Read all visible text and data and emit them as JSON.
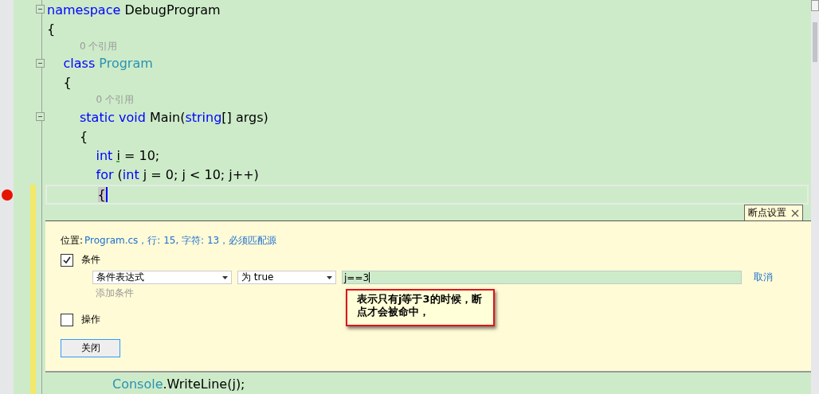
{
  "code": [
    {
      "kind": "code",
      "fold": true,
      "tokens": [
        {
          "text": "namespace",
          "kind": "keyword"
        },
        {
          "text": " DebugProgram",
          "kind": "plain"
        }
      ]
    },
    {
      "kind": "code",
      "tokens": [
        {
          "text": "{",
          "kind": "plain"
        }
      ],
      "children": [
        {
          "kind": "codelens",
          "text": "0 个引用"
        },
        {
          "kind": "code",
          "fold": true,
          "tokens": [
            {
              "text": "class",
              "kind": "keyword"
            },
            {
              "text": " Program",
              "kind": "type"
            }
          ]
        },
        {
          "kind": "code",
          "tokens": [
            {
              "text": "{",
              "kind": "plain"
            }
          ],
          "children": [
            {
              "kind": "codelens",
              "text": "0 个引用"
            },
            {
              "kind": "code",
              "fold": true,
              "tokens": [
                {
                  "text": "static",
                  "kind": "keyword"
                },
                {
                  "text": " void",
                  "kind": "keyword"
                },
                {
                  "text": " Main(",
                  "kind": "plain"
                },
                {
                  "text": "string",
                  "kind": "keyword"
                },
                {
                  "text": "[] args)",
                  "kind": "plain"
                }
              ]
            },
            {
              "kind": "code",
              "tokens": [
                {
                  "text": "{",
                  "kind": "plain"
                }
              ],
              "children": [
                {
                  "kind": "code",
                  "tokens": [
                    {
                      "text": "int ",
                      "kind": "keyword"
                    },
                    {
                      "text": "i",
                      "kind": "warning"
                    },
                    {
                      "text": " = 10;",
                      "kind": "plain"
                    }
                  ]
                },
                {
                  "kind": "code",
                  "tokens": [
                    {
                      "text": "for",
                      "kind": "keyword"
                    },
                    {
                      "text": " (",
                      "kind": "plain"
                    },
                    {
                      "text": "int",
                      "kind": "keyword"
                    },
                    {
                      "text": " j = 0; j < 10; j++)",
                      "kind": "plain"
                    }
                  ]
                },
                {
                  "kind": "code",
                  "breakpoint": true,
                  "current": true,
                  "tokens": [
                    {
                      "text": "{",
                      "kind": "brace"
                    }
                  ],
                  "children": [
                    {
                      "kind": "code",
                      "tokens": [
                        {
                          "text": "Console",
                          "kind": "type"
                        },
                        {
                          "text": ".WriteLine(j);",
                          "kind": "plain"
                        }
                      ]
                    }
                  ]
                }
              ]
            }
          ]
        }
      ]
    }
  ],
  "breakpoint_settings": {
    "tab": "断点设置",
    "location_label": "位置:",
    "location": "Program.cs，行: 15, 字符: 13，必须匹配源",
    "conditions": {
      "label": "条件",
      "checked": true
    },
    "dropdowns": [
      "条件表达式",
      "为 true"
    ],
    "expression": "j==3",
    "cancel": "取消",
    "add_condition": "添加条件",
    "actions": {
      "label": "操作",
      "checked": false
    },
    "close_button": "关闭"
  },
  "annotation": {
    "text": "表示只有j等于3的时候，断点才会被命中，"
  }
}
